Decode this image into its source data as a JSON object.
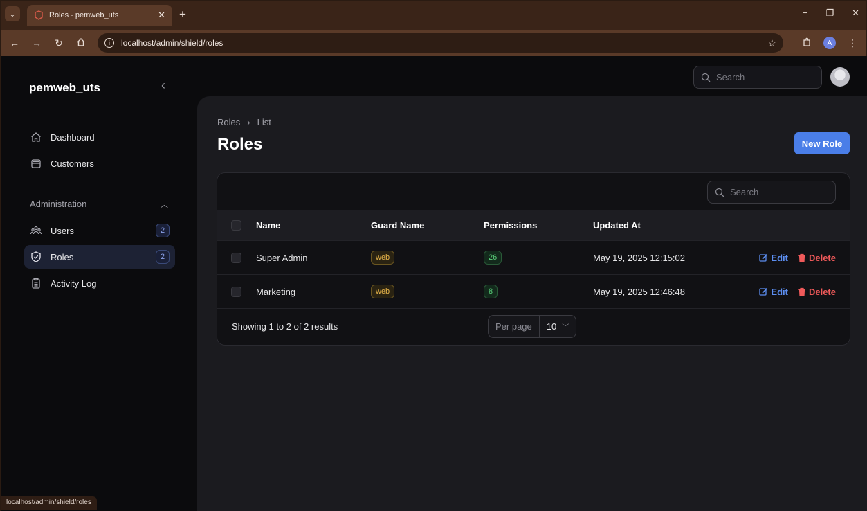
{
  "browser": {
    "tab_title": "Roles - pemweb_uts",
    "url": "localhost/admin/shield/roles",
    "profile_initial": "A",
    "status_url": "localhost/admin/shield/roles"
  },
  "sidebar": {
    "brand": "pemweb_uts",
    "items": [
      {
        "label": "Dashboard",
        "icon": "home-icon"
      },
      {
        "label": "Customers",
        "icon": "inbox-icon"
      }
    ],
    "group_label": "Administration",
    "admin_items": [
      {
        "label": "Users",
        "icon": "users-icon",
        "badge": "2"
      },
      {
        "label": "Roles",
        "icon": "shield-icon",
        "badge": "2",
        "active": true
      },
      {
        "label": "Activity Log",
        "icon": "clipboard-icon"
      }
    ]
  },
  "topbar": {
    "search_placeholder": "Search"
  },
  "page": {
    "breadcrumb": [
      "Roles",
      "List"
    ],
    "title": "Roles",
    "new_button": "New Role"
  },
  "table": {
    "search_placeholder": "Search",
    "columns": [
      "Name",
      "Guard Name",
      "Permissions",
      "Updated At"
    ],
    "rows": [
      {
        "name": "Super Admin",
        "guard": "web",
        "permissions": "26",
        "updated": "May 19, 2025 12:15:02"
      },
      {
        "name": "Marketing",
        "guard": "web",
        "permissions": "8",
        "updated": "May 19, 2025 12:46:48"
      }
    ],
    "edit_label": "Edit",
    "delete_label": "Delete",
    "results": "Showing 1 to 2 of 2 results",
    "per_page_label": "Per page",
    "per_page_value": "10"
  },
  "colors": {
    "accent": "#4a7ee8",
    "edit": "#5c8ef0",
    "delete": "#f05a5a",
    "badge_web": "#e8b54a",
    "badge_perm": "#5ad07a"
  }
}
